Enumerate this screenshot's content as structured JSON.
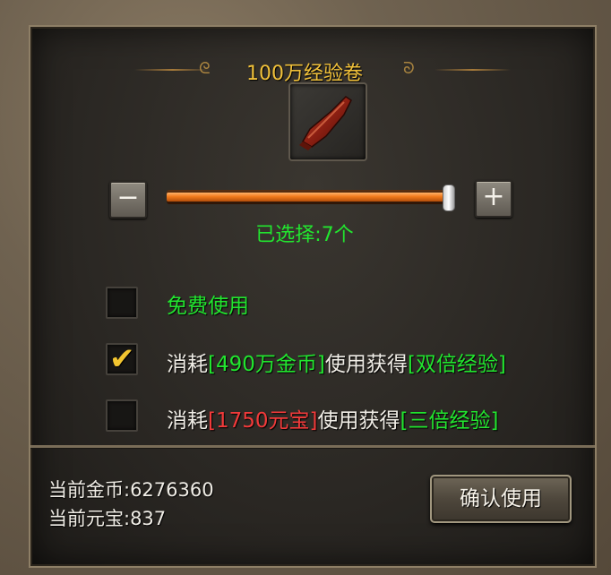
{
  "dialog": {
    "title": "100万经验卷",
    "item_icon": "scroll-icon",
    "minus_label": "−",
    "plus_label": "+",
    "quantity_fraction": 1.0,
    "selected_text": "已选择:7个"
  },
  "options": [
    {
      "checked": false,
      "parts": [
        {
          "text": "免费使用",
          "color": "green"
        }
      ]
    },
    {
      "checked": true,
      "parts": [
        {
          "text": "消耗",
          "color": "white"
        },
        {
          "text": "[490万金币]",
          "color": "green"
        },
        {
          "text": "使用获得",
          "color": "white"
        },
        {
          "text": "[双倍经验]",
          "color": "green"
        }
      ]
    },
    {
      "checked": false,
      "parts": [
        {
          "text": "消耗",
          "color": "white"
        },
        {
          "text": "[1750元宝]",
          "color": "red"
        },
        {
          "text": "使用获得",
          "color": "white"
        },
        {
          "text": "[三倍经验]",
          "color": "green"
        }
      ]
    }
  ],
  "footer": {
    "gold": "当前金币:6276360",
    "yuanbao": "当前元宝:837",
    "confirm_label": "确认使用"
  },
  "colors": {
    "accent": "#f1c13a",
    "green": "#22e52f",
    "red": "#f23a3a"
  },
  "check_glyph": "✔"
}
